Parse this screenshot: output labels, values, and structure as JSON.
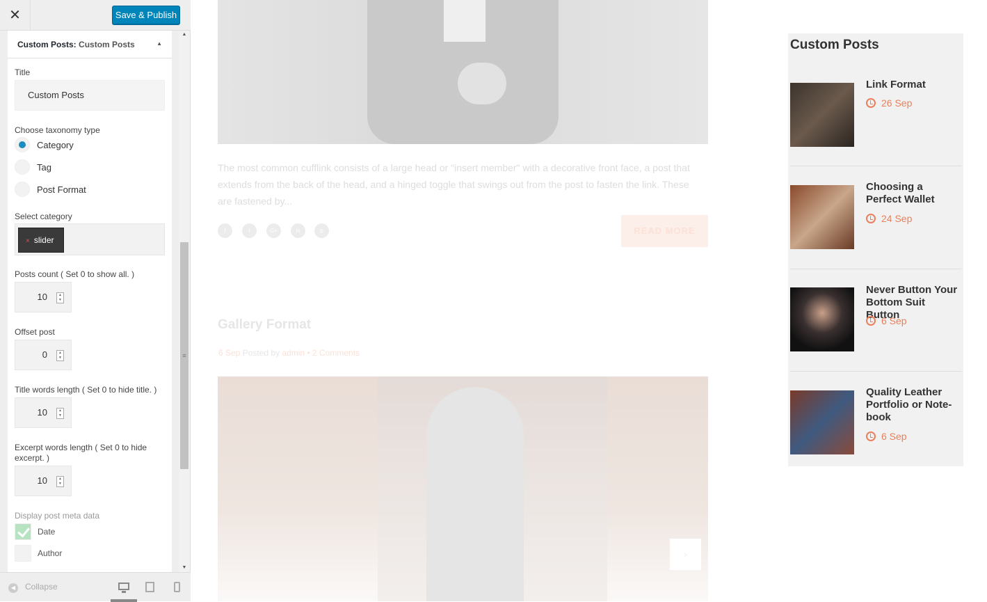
{
  "header": {
    "close_label": "✕",
    "save_label": "Save & Publish"
  },
  "widget": {
    "title_prefix": "Custom Posts:",
    "title_name": "Custom Posts",
    "toggle": "▲"
  },
  "form": {
    "title_label": "Title",
    "title_value": "Custom Posts",
    "taxonomy_label": "Choose taxonomy type",
    "taxonomy_options": [
      {
        "label": "Category",
        "selected": true
      },
      {
        "label": "Tag",
        "selected": false
      },
      {
        "label": "Post Format",
        "selected": false
      }
    ],
    "category_label": "Select category",
    "category_tag": "slider",
    "category_remove": "×",
    "posts_count_label": "Posts count ( Set 0 to show all. )",
    "posts_count": "10",
    "offset_label": "Offset post",
    "offset": "0",
    "title_words_label": "Title words length ( Set 0 to hide title. )",
    "title_words": "10",
    "excerpt_words_label": "Excerpt words length ( Set 0 to hide excerpt. )",
    "excerpt_words": "10",
    "meta_label": "Display post meta data",
    "meta_options": [
      {
        "label": "Date",
        "checked": true
      },
      {
        "label": "Author",
        "checked": false
      }
    ]
  },
  "scrollbar": {
    "up": "▲",
    "down": "▼",
    "grip": "≡"
  },
  "footer": {
    "collapse_label": "Collapse",
    "collapse_icon": "◀"
  },
  "preview": {
    "excerpt": "The most common cufflink consists of a large head or \"insert member\" with a decorative front face, a post that extends from the back of the head, and a hinged toggle that swings out from the post to fasten the link. These are fastened by...",
    "social_icons": [
      "f",
      "t",
      "G+",
      "in",
      "p"
    ],
    "read_more": "READ MORE",
    "post2_title": "Gallery Format",
    "post2_date": "6 Sep",
    "post2_posted_by": "Posted by",
    "post2_author": "admin",
    "post2_sep": "•",
    "post2_comments": "2 Comments",
    "slider_next": "›"
  },
  "custom_posts_widget": {
    "title": "Custom Posts",
    "accent_color": "#e8805d",
    "items": [
      {
        "title": "Link Format",
        "date": "26 Sep"
      },
      {
        "title": "Choosing a Perfect Wallet",
        "date": "24 Sep"
      },
      {
        "title": "Never Button Your Bottom Suit Button",
        "date": "6 Sep"
      },
      {
        "title": "Quality Leather Portfolio or Note-book",
        "date": "6 Sep"
      }
    ]
  }
}
